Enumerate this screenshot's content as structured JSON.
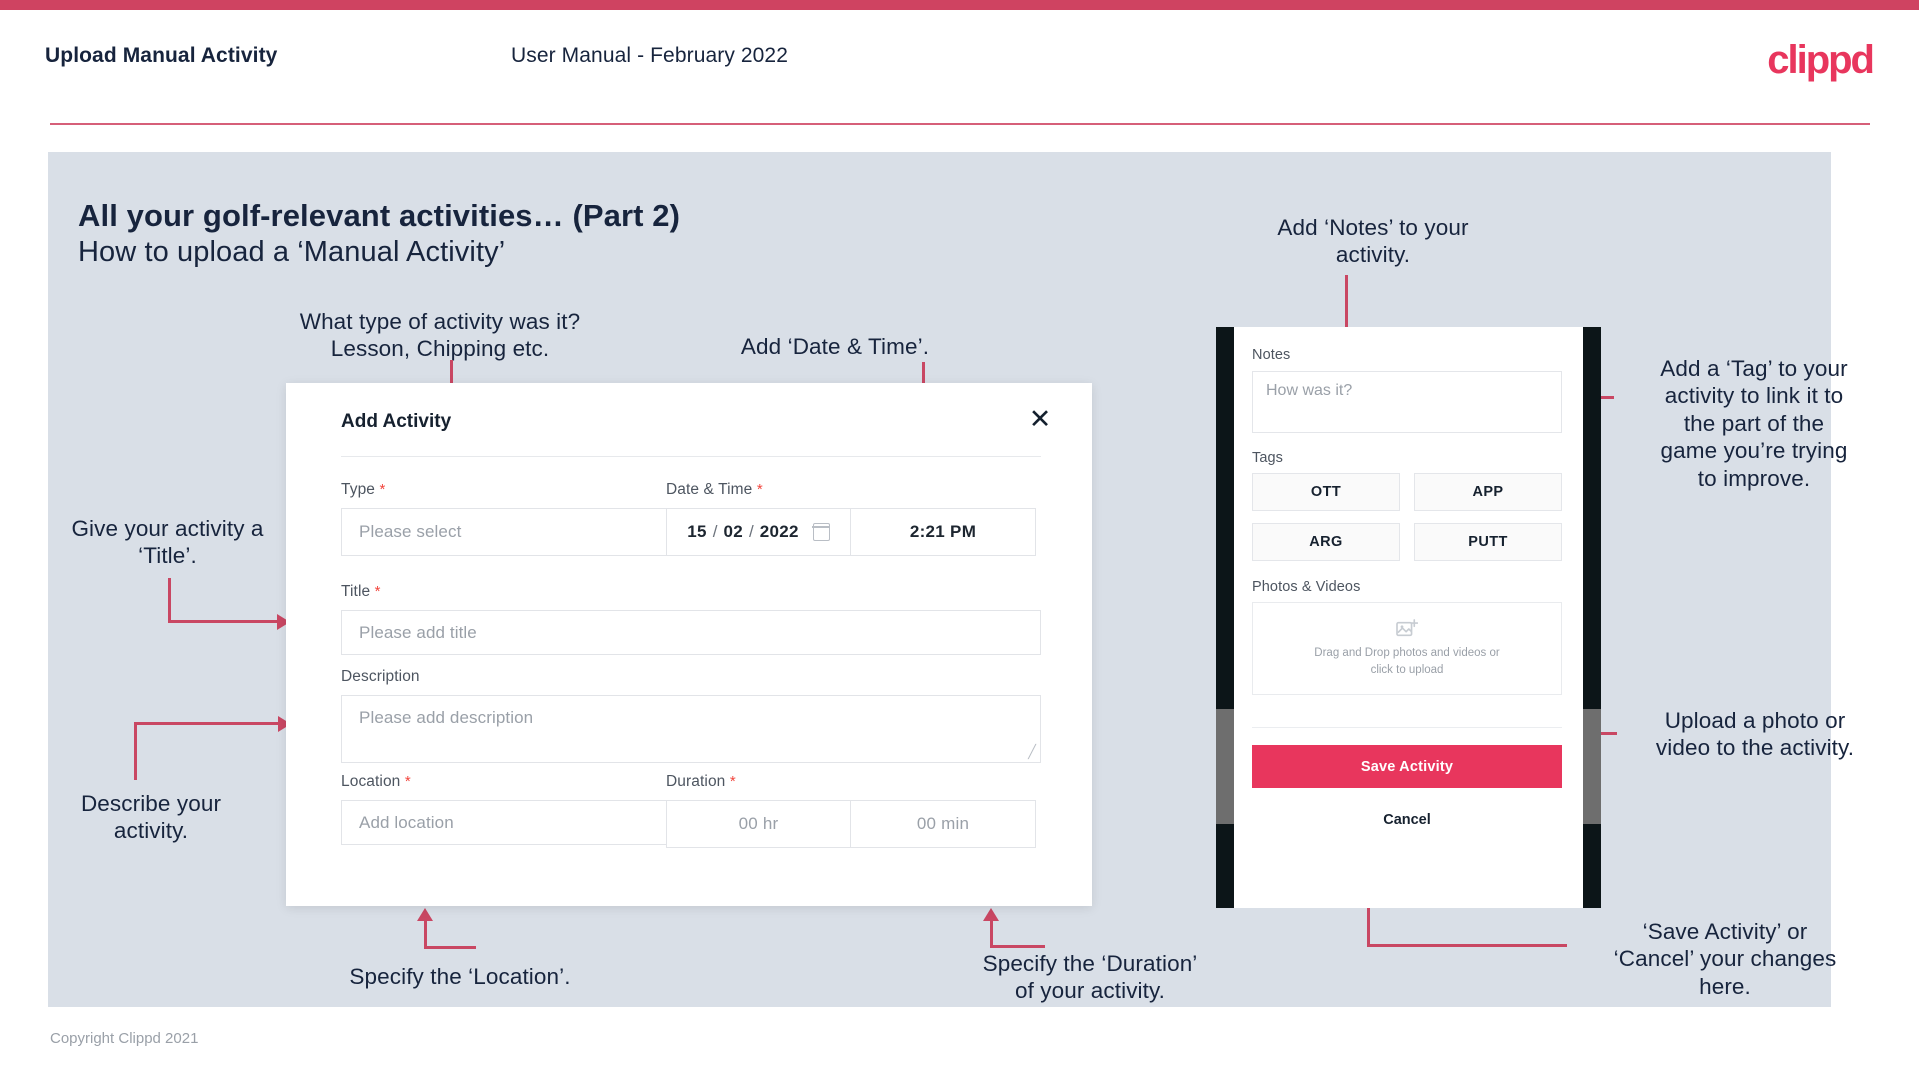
{
  "header": {
    "left_title": "Upload Manual Activity",
    "center_title": "User Manual - February 2022",
    "logo_text": "clippd"
  },
  "slide": {
    "title": "All your golf-relevant activities… (Part 2)",
    "subtitle": "How to upload a ‘Manual Activity’"
  },
  "annotations": {
    "type": "What type of activity was it?\nLesson, Chipping etc.",
    "datetime": "Add ‘Date & Time’.",
    "title_field": "Give your activity a\n‘Title’.",
    "description": "Describe your\nactivity.",
    "location": "Specify the ‘Location’.",
    "duration": "Specify the ‘Duration’\nof your activity.",
    "notes": "Add ‘Notes’ to your\nactivity.",
    "tags": "Add a ‘Tag’ to your\nactivity to link it to\nthe part of the\ngame you’re trying\nto improve.",
    "photos": "Upload a photo or\nvideo to the activity.",
    "save_cancel": "‘Save Activity’ or\n‘Cancel’ your changes\nhere."
  },
  "dialog": {
    "title": "Add Activity",
    "close_icon": "close-icon",
    "fields": {
      "type": {
        "label": "Type",
        "required": "*",
        "placeholder": "Please select",
        "caret": "chevron-down-icon"
      },
      "datetime": {
        "label": "Date & Time",
        "required": "*",
        "day": "15",
        "month": "02",
        "year": "2022",
        "sep": "/",
        "calendar_icon": "calendar-icon",
        "time": "2:21 PM"
      },
      "title": {
        "label": "Title",
        "required": "*",
        "placeholder": "Please add title"
      },
      "description": {
        "label": "Description",
        "required": "",
        "placeholder": "Please add description"
      },
      "location": {
        "label": "Location",
        "required": "*",
        "placeholder": "Add location"
      },
      "duration": {
        "label": "Duration",
        "required": "*",
        "hours": "00 hr",
        "minutes": "00 min"
      }
    }
  },
  "phone": {
    "notes": {
      "label": "Notes",
      "placeholder": "How was it?"
    },
    "tags": {
      "label": "Tags",
      "items": [
        "OTT",
        "APP",
        "ARG",
        "PUTT"
      ]
    },
    "photos": {
      "label": "Photos & Videos",
      "icon": "add-image-icon",
      "drop_line1": "Drag and Drop photos and videos or",
      "drop_line2": "click to upload"
    },
    "save_label": "Save Activity",
    "cancel_label": "Cancel"
  },
  "footer": {
    "copyright": "Copyright Clippd 2021"
  },
  "colors": {
    "accent": "#cf4361",
    "brand_pink": "#e8365d",
    "slide_bg": "#d9dfe7",
    "text_dark": "#17243d",
    "arrow": "#c94763",
    "required": "#f2453d"
  }
}
